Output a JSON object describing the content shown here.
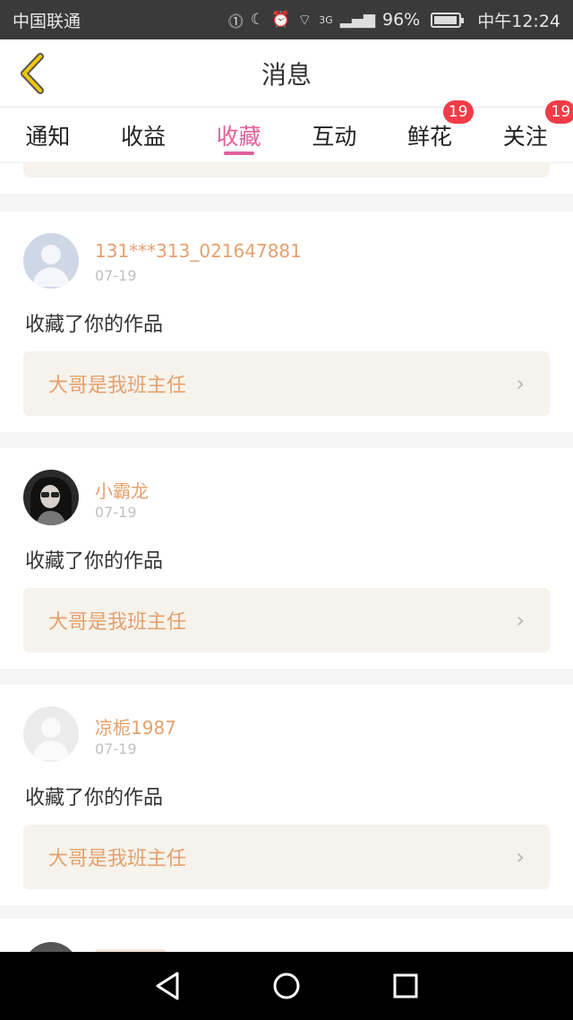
{
  "status_bar": {
    "carrier": "中国联通",
    "network": "3G",
    "battery": "96%",
    "battery_level": 0.96,
    "time": "中午12:24"
  },
  "header": {
    "title": "消息"
  },
  "tabs": [
    {
      "label": "通知"
    },
    {
      "label": "收益"
    },
    {
      "label": "收藏",
      "active": true
    },
    {
      "label": "互动"
    },
    {
      "label": "鲜花",
      "badge": "19"
    },
    {
      "label": "关注",
      "badge": "19"
    }
  ],
  "messages": [
    {
      "username": "131***313_021647881",
      "date": "07-19",
      "action": "收藏了你的作品",
      "work_title": "大哥是我班主任",
      "avatar": "default-avatar-blue"
    },
    {
      "username": "小霸龙",
      "date": "07-19",
      "action": "收藏了你的作品",
      "work_title": "大哥是我班主任",
      "avatar": "photo-avatar"
    },
    {
      "username": "凉栀1987",
      "date": "07-19",
      "action": "收藏了你的作品",
      "work_title": "大哥是我班主任",
      "avatar": "default-avatar-gray"
    }
  ],
  "colors": {
    "accent_pink": "#e0609a",
    "username_orange": "#e5a06d",
    "badge_red": "#f23c48",
    "back_arrow_yellow": "#f0c800"
  }
}
